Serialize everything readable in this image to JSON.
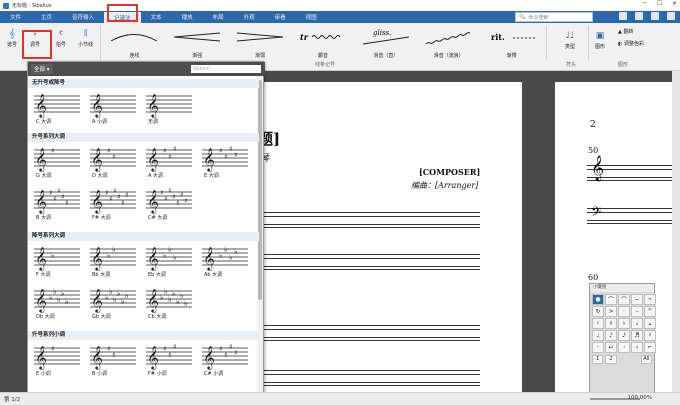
{
  "window": {
    "title": "无标题 - Sibelius"
  },
  "tabs": [
    {
      "label": "文件"
    },
    {
      "label": "主页"
    },
    {
      "label": "音符输入"
    },
    {
      "label": "记谱法"
    },
    {
      "label": "文本"
    },
    {
      "label": "播放"
    },
    {
      "label": "布局"
    },
    {
      "label": "外观"
    },
    {
      "label": "审看"
    },
    {
      "label": "视图"
    }
  ],
  "search": {
    "placeholder": "命令搜索"
  },
  "ribbon": {
    "left_buttons": [
      {
        "label": "谱号"
      },
      {
        "label": "调号"
      },
      {
        "label": "拍号"
      },
      {
        "label": "小节线"
      }
    ],
    "lines": [
      {
        "label": "连线"
      },
      {
        "label": "渐强"
      },
      {
        "label": "渐弱"
      },
      {
        "label": "颤音"
      },
      {
        "label": "滑音（直）"
      },
      {
        "label": "滑音（波浪）"
      },
      {
        "label": "渐慢"
      }
    ],
    "gliss_text": "gliss.",
    "rit_text": "rit.",
    "tr_text": "tr",
    "group_lines": "线条记号",
    "group_noteheads": "符头",
    "group_graphics": "图形",
    "types_label": "类型",
    "graphic_label": "图形",
    "flip_label": "翻转",
    "color_label": "调整色彩"
  },
  "popup": {
    "filter": "全部",
    "search_placeholder": "Search",
    "sections": [
      {
        "title": "无升号或降号",
        "keys": [
          {
            "label": "C 大调"
          },
          {
            "label": "A 小调"
          },
          {
            "label": "无调"
          }
        ]
      },
      {
        "title": "升号系列大调",
        "keys": [
          {
            "label": "G 大调"
          },
          {
            "label": "D 大调"
          },
          {
            "label": "A 大调"
          },
          {
            "label": "E 大调"
          },
          {
            "label": "B 大调"
          },
          {
            "label": "F# 大调"
          },
          {
            "label": "C# 大调"
          }
        ]
      },
      {
        "title": "降号系列大调",
        "keys": [
          {
            "label": "F 大调"
          },
          {
            "label": "Bb 大调"
          },
          {
            "label": "Eb 大调"
          },
          {
            "label": "Ab 大调"
          },
          {
            "label": "Db 大调"
          },
          {
            "label": "Gb 大调"
          },
          {
            "label": "Cb 大调"
          }
        ]
      },
      {
        "title": "升号系列小调",
        "keys": [
          {
            "label": "E 小调"
          },
          {
            "label": "B 小调"
          },
          {
            "label": "F# 小调"
          },
          {
            "label": "C# 小调"
          }
        ]
      }
    ]
  },
  "score": {
    "title_fragment": "题]",
    "instrument_fragment": "琴",
    "composer": "[COMPOSER]",
    "arranger": "编曲：[Arranger]",
    "page_num": "2",
    "bar_50": "50",
    "bar_60": "60"
  },
  "keypad": {
    "title": "小键盘",
    "buttons": [
      "1",
      "2",
      "All"
    ]
  },
  "status": {
    "page": "第 1/2",
    "zoom": "100.00%"
  }
}
